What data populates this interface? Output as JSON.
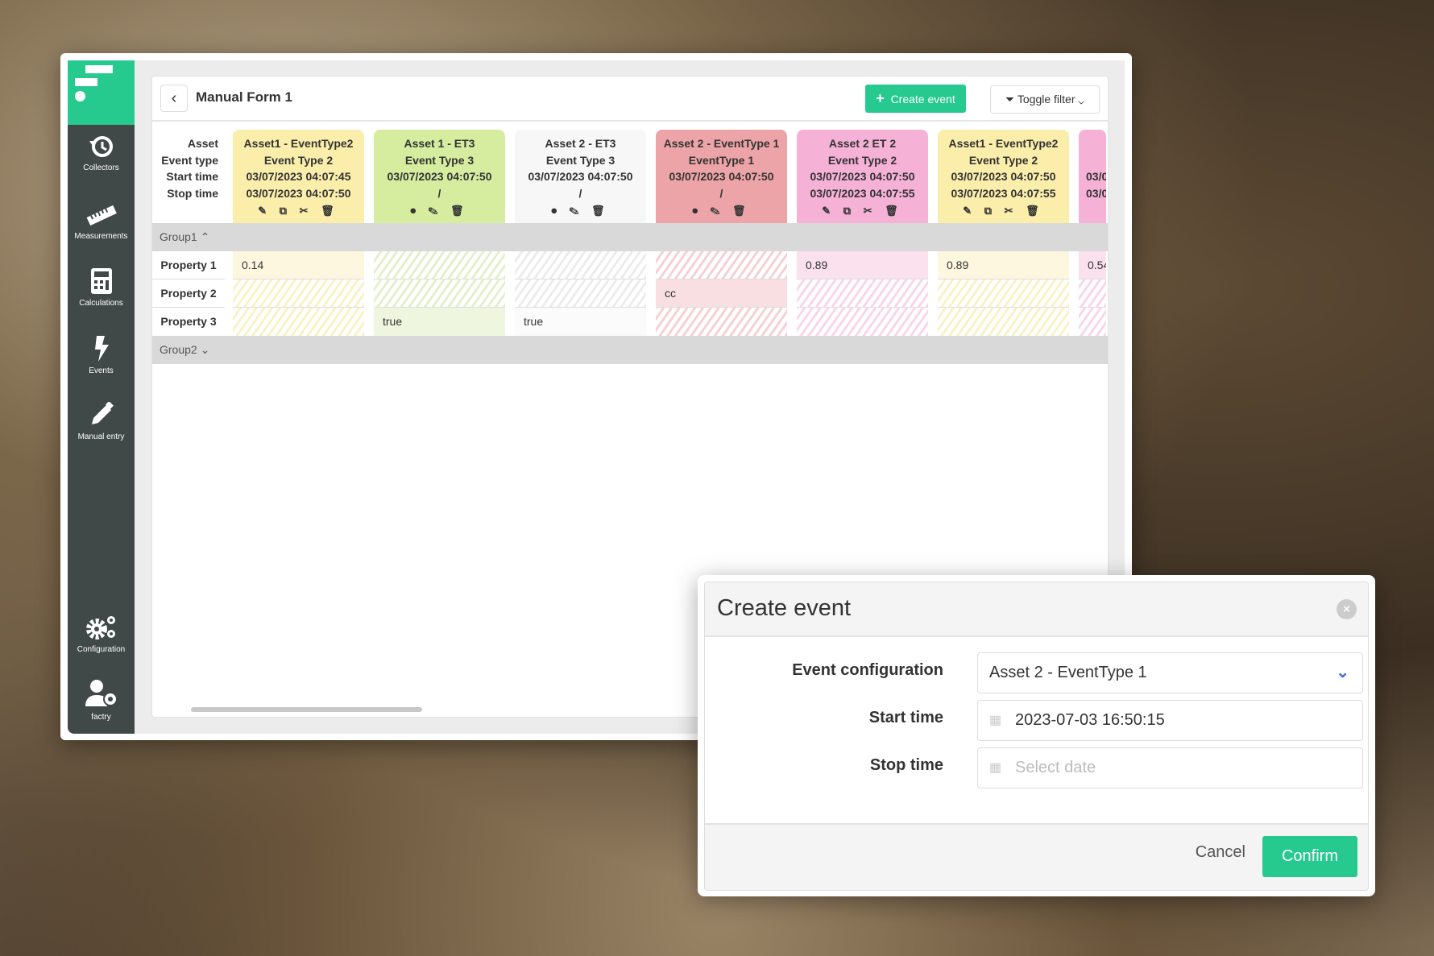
{
  "sidebar": {
    "items": [
      {
        "label": "Collectors",
        "icon": "history-icon"
      },
      {
        "label": "Measurements",
        "icon": "ruler-icon"
      },
      {
        "label": "Calculations",
        "icon": "calculator-icon"
      },
      {
        "label": "Events",
        "icon": "bolt-icon"
      },
      {
        "label": "Manual entry",
        "icon": "pen-icon"
      },
      {
        "label": "Configuration",
        "icon": "gears-icon"
      },
      {
        "label": "factry",
        "icon": "user-gear-icon"
      }
    ]
  },
  "header": {
    "title": "Manual Form 1",
    "create_label": "Create event",
    "filter_label": "Toggle filter"
  },
  "row_labels": [
    "Asset",
    "Event type",
    "Start time",
    "Stop time"
  ],
  "columns": [
    {
      "asset": "Asset1 - EventType2",
      "type": "Event Type 2",
      "start": "03/07/2023 04:07:45",
      "stop": "03/07/2023 04:07:50",
      "icons": "✎ ⧉ ✂ 🗑",
      "color": "#fbeeab",
      "cell": "#fdf7e0",
      "hatch": "#fbf1c6"
    },
    {
      "asset": "Asset 1 - ET3",
      "type": "Event Type 3",
      "start": "03/07/2023 04:07:50",
      "stop": "/",
      "icons": "⏺ ✎ 🗑",
      "color": "#d6eda0",
      "cell": "#eef6df",
      "hatch": "#e2f1cb"
    },
    {
      "asset": "Asset 2 - ET3",
      "type": "Event Type 3",
      "start": "03/07/2023 04:07:50",
      "stop": "/",
      "icons": "⏺ ✎ 🗑",
      "color": "#f7f7f7",
      "cell": "#fbfbfb",
      "hatch": "#ececec"
    },
    {
      "asset": "Asset 2 - EventType 1",
      "type": "EventType 1",
      "start": "03/07/2023 04:07:50",
      "stop": "/",
      "icons": "⏺ ✎ 🗑",
      "color": "#eda4a9",
      "cell": "#f9dfe1",
      "hatch": "#f6d0d3"
    },
    {
      "asset": "Asset 2 ET 2",
      "type": "Event Type 2",
      "start": "03/07/2023 04:07:50",
      "stop": "03/07/2023 04:07:55",
      "icons": "✎ ⧉ ✂ 🗑",
      "color": "#f6b1d6",
      "cell": "#fbe1ee",
      "hatch": "#f9d6e8"
    },
    {
      "asset": "Asset1 - EventType2",
      "type": "Event Type 2",
      "start": "03/07/2023 04:07:50",
      "stop": "03/07/2023 04:07:55",
      "icons": "✎ ⧉ ✂ 🗑",
      "color": "#fbeeab",
      "cell": "#fdf7e0",
      "hatch": "#fbf1c6"
    },
    {
      "asset": "",
      "type": "",
      "start": "03/0",
      "stop": "03/0",
      "icons": "",
      "color": "#f6b1d6",
      "cell": "#fbe1ee",
      "hatch": "#f9d6e8"
    }
  ],
  "groups": [
    {
      "label": "Group1",
      "expanded": true
    },
    {
      "label": "Group2",
      "expanded": false
    }
  ],
  "properties": [
    "Property 1",
    "Property 2",
    "Property 3"
  ],
  "values": [
    [
      "0.14",
      null,
      null
    ],
    [
      null,
      null,
      "true"
    ],
    [
      null,
      null,
      "true"
    ],
    [
      null,
      "cc",
      null
    ],
    [
      "0.89",
      null,
      null
    ],
    [
      "0.89",
      null,
      null
    ],
    [
      "0.54",
      null,
      null
    ]
  ],
  "dialog": {
    "title": "Create event",
    "event_config_label": "Event configuration",
    "event_config_value": "Asset 2 - EventType 1",
    "start_label": "Start time",
    "start_value": "2023-07-03 16:50:15",
    "stop_label": "Stop time",
    "stop_placeholder": "Select date",
    "cancel": "Cancel",
    "confirm": "Confirm",
    "accent": "#26c98e"
  }
}
